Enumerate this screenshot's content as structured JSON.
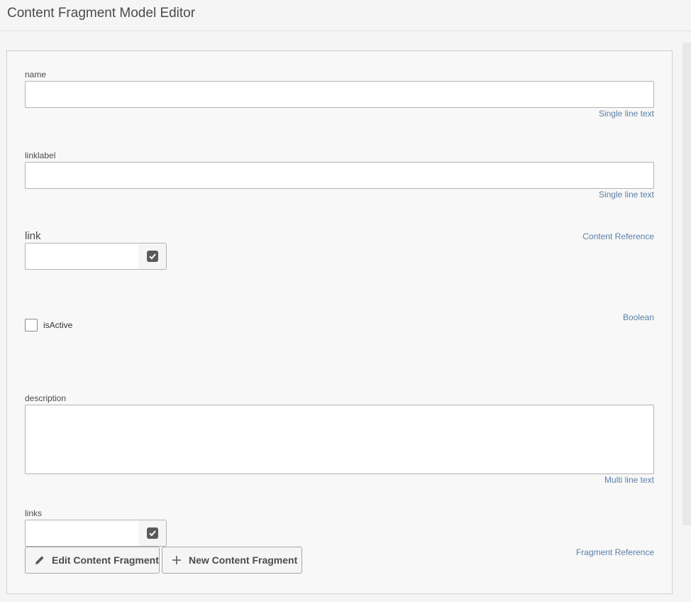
{
  "header": {
    "title": "Content Fragment Model Editor"
  },
  "fields": {
    "name": {
      "label": "name",
      "type": "Single line text",
      "value": ""
    },
    "linklabel": {
      "label": "linklabel",
      "type": "Single line text",
      "value": ""
    },
    "link": {
      "label": "link",
      "type": "Content Reference",
      "value": ""
    },
    "isActive": {
      "label": "isActive",
      "type": "Boolean",
      "checked": false
    },
    "description": {
      "label": "description",
      "type": "Multi line text",
      "value": ""
    },
    "links": {
      "label": "links",
      "type": "Fragment Reference",
      "value": "",
      "edit_button": "Edit Content Fragment",
      "new_button": "New Content Fragment"
    }
  },
  "icons": {
    "picker": "check-square-icon",
    "edit": "pencil-icon",
    "add": "plus-icon"
  },
  "colors": {
    "type_tag": "#5a7fa8",
    "background": "#f5f5f5"
  }
}
